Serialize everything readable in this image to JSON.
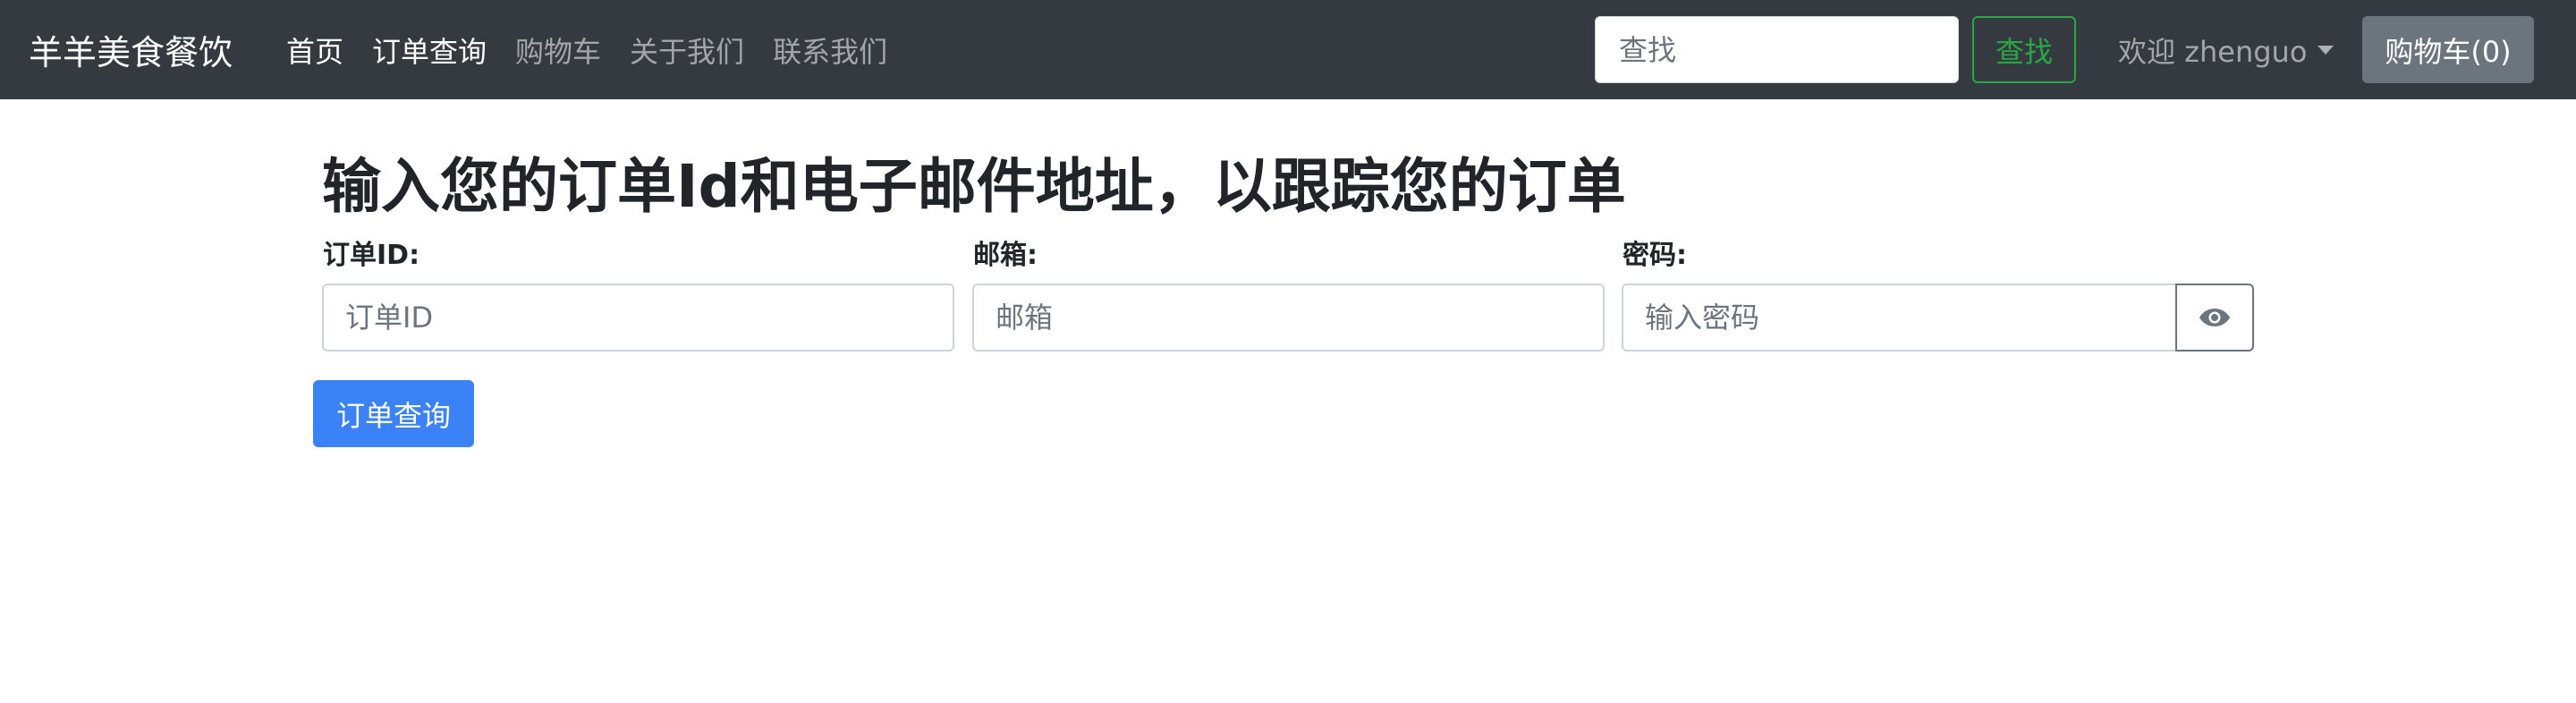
{
  "navbar": {
    "brand": "羊羊美食餐饮",
    "links": [
      {
        "label": "首页",
        "active": true
      },
      {
        "label": "订单查询",
        "active": true
      },
      {
        "label": "购物车",
        "active": false
      },
      {
        "label": "关于我们",
        "active": false
      },
      {
        "label": "联系我们",
        "active": false
      }
    ],
    "search_placeholder": "查找",
    "search_button": "查找",
    "welcome": "欢迎 zhenguo",
    "cart_button": "购物车(0)"
  },
  "main": {
    "title": "输入您的订单Id和电子邮件地址，以跟踪您的订单",
    "order_id": {
      "label": "订单ID:",
      "placeholder": "订单ID",
      "value": ""
    },
    "email": {
      "label": "邮箱:",
      "placeholder": "邮箱",
      "value": ""
    },
    "password": {
      "label": "密码:",
      "placeholder": "输入密码",
      "value": ""
    },
    "eye_icon": "eye-icon",
    "submit_button": "订单查询"
  },
  "colors": {
    "navbar_bg": "#343a40",
    "search_button": "#28a745",
    "cart_button_bg": "#6c757d",
    "submit_bg": "#3b82f6"
  }
}
